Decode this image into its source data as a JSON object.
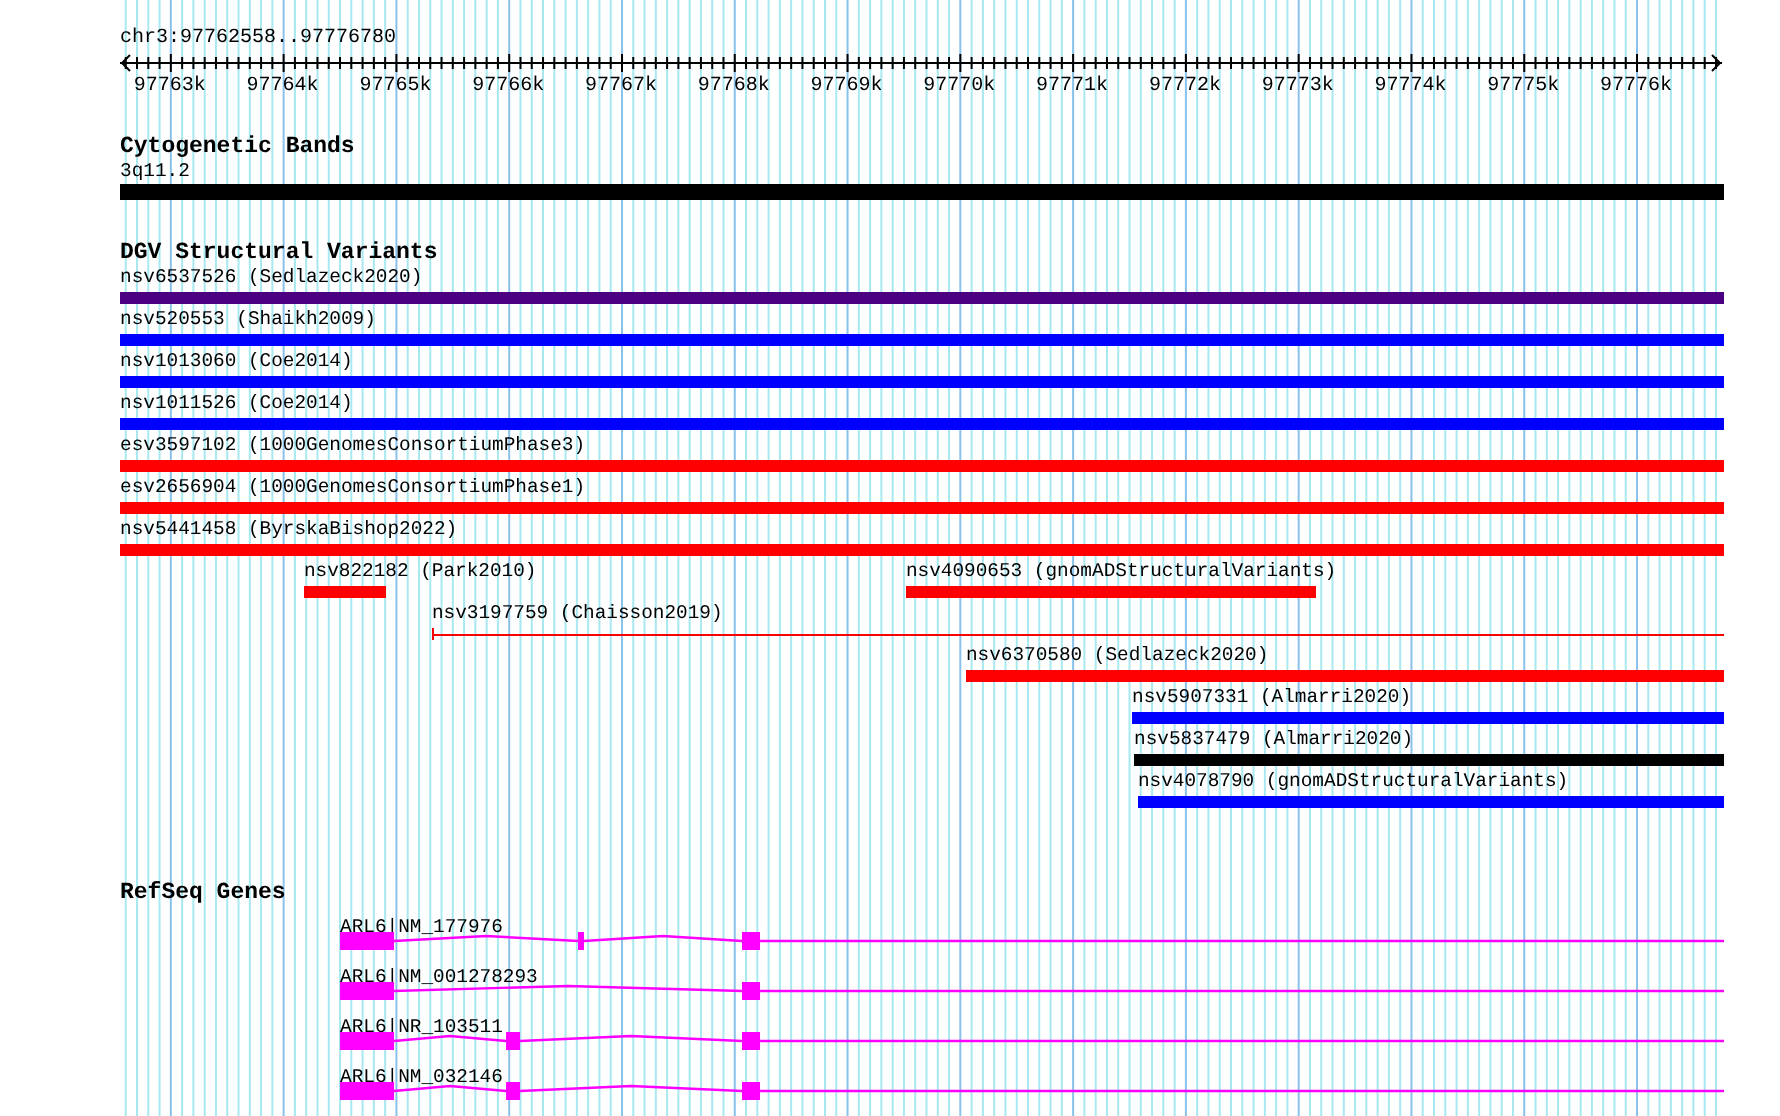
{
  "ruler": {
    "location": "chr3:97762558..97776780",
    "ticks": [
      "97763k",
      "97764k",
      "97765k",
      "97766k",
      "97767k",
      "97768k",
      "97769k",
      "97770k",
      "97771k",
      "97772k",
      "97773k",
      "97774k",
      "97775k",
      "97776k"
    ]
  },
  "tracks": [
    {
      "kind": "bands",
      "title": "Cytogenetic Bands",
      "bands": [
        {
          "name": "3q11.2",
          "color": "#000000"
        }
      ]
    },
    {
      "kind": "variants",
      "title": "DGV Structural Variants",
      "rows": [
        {
          "features": [
            {
              "kind": "bar",
              "label": "nsv6537526 (Sedlazeck2020)",
              "color": "#4b0082"
            }
          ]
        },
        {
          "features": [
            {
              "kind": "bar",
              "label": "nsv520553 (Shaikh2009)",
              "color": "#0000ff"
            }
          ]
        },
        {
          "features": [
            {
              "kind": "bar",
              "label": "nsv1013060 (Coe2014)",
              "color": "#0000ff"
            }
          ]
        },
        {
          "features": [
            {
              "kind": "bar",
              "label": "nsv1011526 (Coe2014)",
              "color": "#0000ff"
            }
          ]
        },
        {
          "features": [
            {
              "kind": "bar",
              "label": "esv3597102 (1000GenomesConsortiumPhase3)",
              "color": "#ff0000"
            }
          ]
        },
        {
          "features": [
            {
              "kind": "bar",
              "label": "esv2656904 (1000GenomesConsortiumPhase1)",
              "color": "#ff0000"
            }
          ]
        },
        {
          "features": [
            {
              "kind": "bar",
              "label": "nsv5441458 (ByrskaBishop2022)",
              "color": "#ff0000"
            }
          ]
        },
        {
          "features": [
            {
              "kind": "bar",
              "label": "nsv822182 (Park2010)",
              "color": "#ff0000"
            },
            {
              "kind": "bar",
              "label": "nsv4090653 (gnomADStructuralVariants)",
              "color": "#ff0000"
            }
          ]
        },
        {
          "features": [
            {
              "kind": "line",
              "label": "nsv3197759 (Chaisson2019)",
              "color": "#ff0000"
            }
          ]
        },
        {
          "features": [
            {
              "kind": "bar",
              "label": "nsv6370580 (Sedlazeck2020)",
              "color": "#ff0000"
            }
          ]
        },
        {
          "features": [
            {
              "kind": "bar",
              "label": "nsv5907331 (Almarri2020)",
              "color": "#0000ff"
            }
          ]
        },
        {
          "features": [
            {
              "kind": "bar",
              "label": "nsv5837479 (Almarri2020)",
              "color": "#000000"
            }
          ]
        },
        {
          "features": [
            {
              "kind": "bar",
              "label": "nsv4078790 (gnomADStructuralVariants)",
              "color": "#0000ff"
            }
          ]
        }
      ]
    },
    {
      "kind": "genes",
      "title": "RefSeq Genes",
      "transcripts": [
        {
          "label": "ARL6|NM_177976"
        },
        {
          "label": "ARL6|NM_001278293"
        },
        {
          "label": "ARL6|NR_103511"
        },
        {
          "label": "ARL6|NM_032146"
        }
      ]
    }
  ]
}
